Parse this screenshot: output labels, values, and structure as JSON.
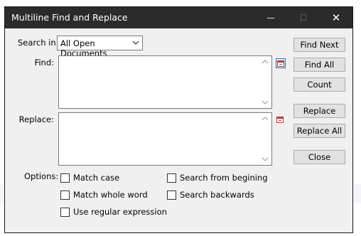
{
  "window": {
    "title": "Multiline Find and Replace",
    "controls": {
      "minimize": "—",
      "maximize": "☐",
      "close": "✕"
    }
  },
  "search_in": {
    "label": "Search in:",
    "value": "All Open Documents"
  },
  "find": {
    "label": "Find:",
    "value": ""
  },
  "replace": {
    "label": "Replace:",
    "value": ""
  },
  "buttons": {
    "find_next": "Find Next",
    "find_all": "Find All",
    "count": "Count",
    "replace": "Replace",
    "replace_all": "Replace All",
    "close": "Close"
  },
  "options": {
    "label": "Options:",
    "match_case": {
      "label": "Match case",
      "checked": false
    },
    "search_from_beginning": {
      "label": "Search from begining",
      "checked": false
    },
    "match_whole_word": {
      "label": "Match whole word",
      "checked": false
    },
    "search_backwards": {
      "label": "Search backwards",
      "checked": false
    },
    "use_regex": {
      "label": "Use regular expression",
      "checked": false
    }
  },
  "colors": {
    "titlebar": "#2b2b2b",
    "dialog_bg": "#f0f0f0",
    "focus": "#0078d7",
    "picker_icon": "#c0392b"
  }
}
